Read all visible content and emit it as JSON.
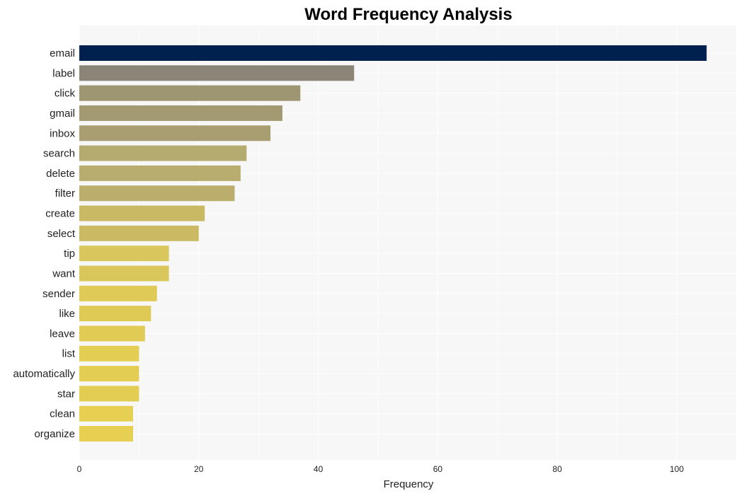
{
  "chart_data": {
    "type": "bar",
    "orientation": "horizontal",
    "title": "Word Frequency Analysis",
    "xlabel": "Frequency",
    "ylabel": "",
    "xlim": [
      0,
      110
    ],
    "xticks": [
      0,
      20,
      40,
      60,
      80,
      100
    ],
    "grid": true,
    "legend": "none",
    "categories": [
      "email",
      "label",
      "click",
      "gmail",
      "inbox",
      "search",
      "delete",
      "filter",
      "create",
      "select",
      "tip",
      "want",
      "sender",
      "like",
      "leave",
      "list",
      "automatically",
      "star",
      "clean",
      "organize"
    ],
    "values": [
      105,
      46,
      37,
      34,
      32,
      28,
      27,
      26,
      21,
      20,
      15,
      15,
      13,
      12,
      11,
      10,
      10,
      10,
      9,
      9
    ],
    "colors": [
      "#00214d",
      "#8a8576",
      "#9e9672",
      "#a39a71",
      "#a89e71",
      "#b5aa6f",
      "#b8ac6e",
      "#bbae6c",
      "#c9b964",
      "#cbba63",
      "#d9c65c",
      "#dac75b",
      "#dfc957",
      "#e0ca56",
      "#e1cb55",
      "#e4cd53",
      "#e4cd53",
      "#e4cd53",
      "#e7cf52",
      "#e7cf52"
    ],
    "plot_background": "#f7f7f7"
  }
}
